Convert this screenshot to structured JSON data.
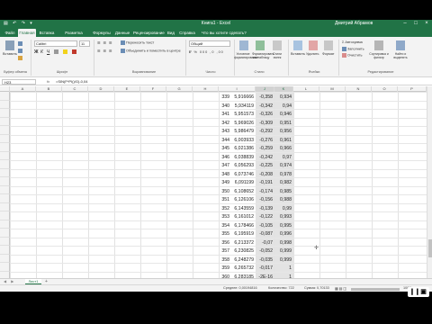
{
  "window": {
    "title": "Книга1 - Excel",
    "user": "Дмитрий Абрамов"
  },
  "tabs": [
    "Файл",
    "Главная",
    "Вставка",
    "Разметка страницы",
    "Формулы",
    "Данные",
    "Рецензирование",
    "Вид",
    "Справка",
    "Что вы хотите сделать?"
  ],
  "ribbon": {
    "paste": "Вставить",
    "clipboard": "Буфер обмена",
    "font_name": "Calibri",
    "font_size": "11",
    "font_group": "Шрифт",
    "wrap_text": "Переносить текст",
    "merge": "Объединить и поместить в центре",
    "alignment": "Выравнивание",
    "number_format": "Общий",
    "number_group": "Число",
    "conditional": "Условное форматирование",
    "format_table": "Форматировать как таблицу",
    "cell_styles": "Стили ячеек",
    "styles_group": "Стили",
    "insert": "Вставить",
    "delete": "Удалить",
    "format": "Формат",
    "cells_group": "Ячейки",
    "autosum": "Автосумма",
    "fill": "Заполнить",
    "clear": "Очистить",
    "sort": "Сортировка и фильтр",
    "find": "Найти и выделить",
    "editing_group": "Редактирование"
  },
  "formula_bar": {
    "name_box": "H23",
    "fx": "fx",
    "formula": "=SIN(F*PI()/G)-0,04"
  },
  "columns": [
    "A",
    "B",
    "C",
    "D",
    "E",
    "F",
    "G",
    "H",
    "I",
    "J",
    "K",
    "L",
    "M",
    "N",
    "O",
    "P",
    "Q",
    "R",
    "S",
    "T"
  ],
  "rows": [
    {
      "n": "339",
      "x": "5,916666",
      "y": "-0,358",
      "z": "0,934"
    },
    {
      "n": "340",
      "x": "5,934119",
      "y": "-0,342",
      "z": "0,94"
    },
    {
      "n": "341",
      "x": "5,951573",
      "y": "-0,326",
      "z": "0,946"
    },
    {
      "n": "342",
      "x": "5,969026",
      "y": "-0,309",
      "z": "0,951"
    },
    {
      "n": "343",
      "x": "5,986479",
      "y": "-0,292",
      "z": "0,956"
    },
    {
      "n": "344",
      "x": "6,003933",
      "y": "-0,276",
      "z": "0,961"
    },
    {
      "n": "345",
      "x": "6,021386",
      "y": "-0,259",
      "z": "0,966"
    },
    {
      "n": "346",
      "x": "6,038839",
      "y": "-0,242",
      "z": "0,97"
    },
    {
      "n": "347",
      "x": "6,056293",
      "y": "-0,225",
      "z": "0,974"
    },
    {
      "n": "348",
      "x": "6,073746",
      "y": "-0,208",
      "z": "0,978"
    },
    {
      "n": "349",
      "x": "6,091199",
      "y": "-0,191",
      "z": "0,982"
    },
    {
      "n": "350",
      "x": "6,108652",
      "y": "-0,174",
      "z": "0,985"
    },
    {
      "n": "351",
      "x": "6,126106",
      "y": "-0,156",
      "z": "0,988"
    },
    {
      "n": "352",
      "x": "6,143559",
      "y": "-0,139",
      "z": "0,99"
    },
    {
      "n": "353",
      "x": "6,161012",
      "y": "-0,122",
      "z": "0,993"
    },
    {
      "n": "354",
      "x": "6,178466",
      "y": "-0,105",
      "z": "0,995"
    },
    {
      "n": "355",
      "x": "6,195919",
      "y": "-0,087",
      "z": "0,996"
    },
    {
      "n": "356",
      "x": "6,213372",
      "y": "-0,07",
      "z": "0,998"
    },
    {
      "n": "357",
      "x": "6,230825",
      "y": "-0,052",
      "z": "0,999"
    },
    {
      "n": "358",
      "x": "6,248279",
      "y": "-0,035",
      "z": "0,999"
    },
    {
      "n": "359",
      "x": "6,265732",
      "y": "-0,017",
      "z": "1"
    },
    {
      "n": "360",
      "x": "6,283185",
      "y": "-2E-16",
      "z": "1"
    }
  ],
  "sheet": {
    "name": "Лист1",
    "add": "+"
  },
  "status": {
    "average": "Среднее: 0,00194816",
    "count": "Количество: 722",
    "sum": "Сумма: 0,70133",
    "zoom": "100%"
  }
}
